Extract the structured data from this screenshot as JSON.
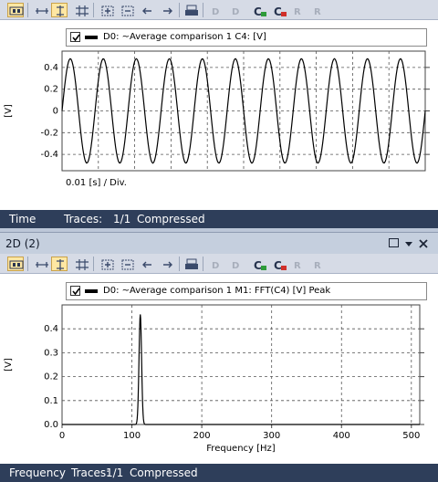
{
  "top_panel": {
    "legend": {
      "checked": true,
      "text": "D0: ~Average comparison 1  C4:  [V]"
    },
    "ylabel": "[V]",
    "div_label": "0.01 [s] / Div.",
    "y_ticks": [
      "0.4",
      "0.2",
      "0",
      "-0.2",
      "-0.4"
    ],
    "status": {
      "mode": "Time",
      "traces_label": "Traces:",
      "traces": "1/1",
      "state": "Compressed"
    }
  },
  "bottom_window": {
    "title": "2D (2)",
    "icons": [
      "restore-icon",
      "dropdown-icon",
      "close-icon"
    ]
  },
  "bottom_panel": {
    "legend": {
      "checked": true,
      "text": "D0: ~Average comparison 1  M1: FFT(C4) [V]  Peak"
    },
    "ylabel": "[V]",
    "xlabel": "Frequency [Hz]",
    "status": {
      "mode": "Frequency",
      "traces_label": "Traces:",
      "traces": "1/1",
      "state": "Compressed"
    }
  },
  "toolbar": {
    "buttons": [
      "cursor-mode-icon",
      "zoom-x-icon",
      "zoom-y-icon",
      "grid-icon",
      "zoom-in-icon",
      "zoom-out-icon",
      "scroll-left-icon",
      "scroll-right-icon",
      "print-icon",
      "d1-icon",
      "d2-icon",
      "add-cursor-icon",
      "remove-cursor-icon",
      "r1-icon",
      "r2-icon"
    ]
  },
  "colors": {
    "status_bg": "#2e3e5a",
    "toolbar_bg": "#d6dbe6",
    "active_btn": "#ffe7a3",
    "trace": "#000000",
    "grid": "#555555"
  },
  "chart_data": [
    {
      "type": "line",
      "title": "",
      "xlabel": "",
      "ylabel": "[V]",
      "ylim": [
        -0.55,
        0.55
      ],
      "x_divisions": 10,
      "x_unit_per_div": "0.01 [s] / Div.",
      "series": [
        {
          "waveform": "sine",
          "amplitude": 0.48,
          "frequency_hz": 110,
          "x_start_s": 0,
          "x_end_s": 0.1
        }
      ]
    },
    {
      "type": "line",
      "title": "",
      "xlabel": "Frequency [Hz]",
      "ylabel": "[V]",
      "xlim": [
        0,
        512
      ],
      "ylim": [
        0,
        0.5
      ],
      "x_ticks": [
        0,
        100,
        200,
        300,
        400,
        500
      ],
      "y_ticks": [
        0.0,
        0.1,
        0.2,
        0.3,
        0.4
      ],
      "series": [
        {
          "peak_hz": 112,
          "peak_value": 0.46,
          "baseline": 0.0
        }
      ]
    }
  ]
}
